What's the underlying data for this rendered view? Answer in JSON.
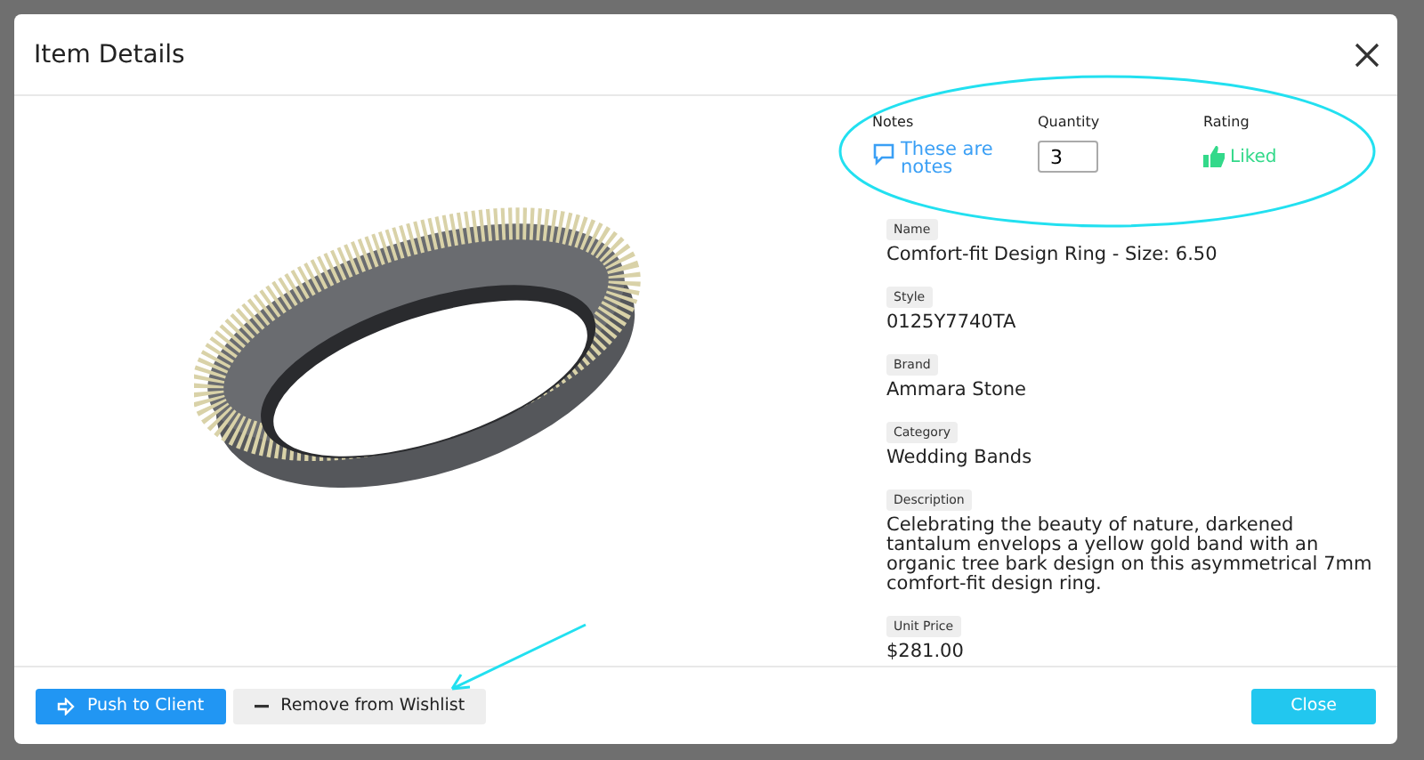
{
  "dialog": {
    "title": "Item Details"
  },
  "summary": {
    "notes": {
      "label": "Notes",
      "text": "These are notes"
    },
    "quantity": {
      "label": "Quantity",
      "value": "3"
    },
    "rating": {
      "label": "Rating",
      "text": "Liked",
      "liked": true
    }
  },
  "fields": [
    {
      "label": "Name",
      "value": "Comfort-fit Design Ring - Size: 6.50"
    },
    {
      "label": "Style",
      "value": "0125Y7740TA"
    },
    {
      "label": "Brand",
      "value": "Ammara Stone"
    },
    {
      "label": "Category",
      "value": "Wedding Bands"
    },
    {
      "label": "Description",
      "value": "Celebrating the beauty of nature, darkened tantalum envelops a yellow gold band with an organic tree bark design on this asymmetrical 7mm comfort-fit design ring."
    },
    {
      "label": "Unit Price",
      "value": "$281.00"
    }
  ],
  "footer": [
    {
      "kind": "primary",
      "label": "Push to Client"
    },
    {
      "kind": "secondary",
      "label": "Remove from Wishlist"
    },
    {
      "kind": "close",
      "label": "Close"
    }
  ]
}
